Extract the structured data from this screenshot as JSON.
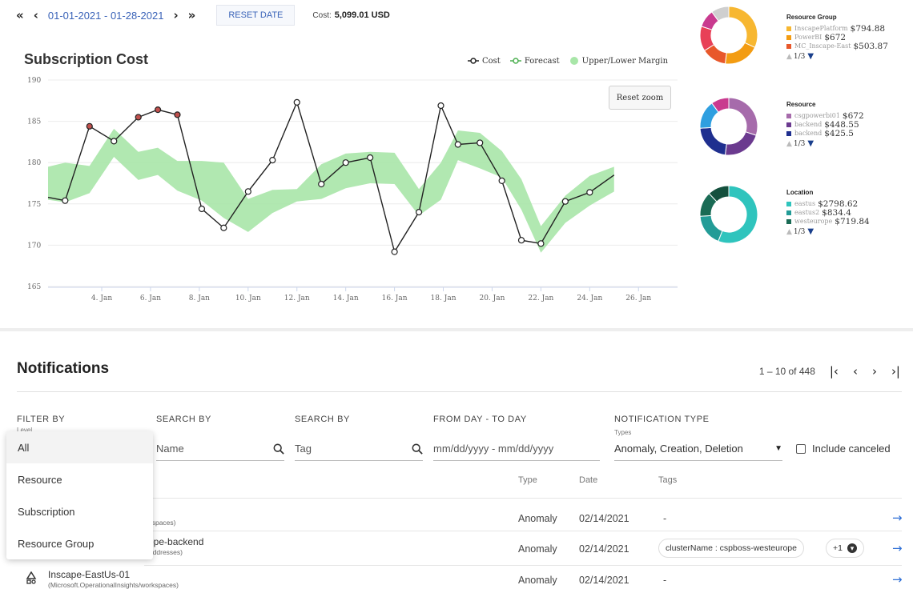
{
  "datebar": {
    "first_btn": "«",
    "prev_btn": "‹",
    "range": "01-01-2021 - 01-28-2021",
    "next_btn": "›",
    "last_btn": "»",
    "reset_label": "RESET DATE",
    "cost_label": "Cost:",
    "cost_value": "5,099.01 USD"
  },
  "chart_data": {
    "type": "line",
    "title": "Subscription Cost",
    "reset_zoom_label": "Reset zoom",
    "legend": [
      "Cost",
      "Forecast",
      "Upper/Lower Margin"
    ],
    "ylim": [
      165,
      190
    ],
    "y_ticks": [
      190,
      185,
      180,
      175,
      170,
      165
    ],
    "x_tick_labels": [
      "4. Jan",
      "6. Jan",
      "8. Jan",
      "10. Jan",
      "12. Jan",
      "14. Jan",
      "16. Jan",
      "18. Jan",
      "20. Jan",
      "22. Jan",
      "24. Jan",
      "26. Jan"
    ],
    "x_tick_days": [
      4,
      6,
      8,
      10,
      12,
      14,
      16,
      18,
      20,
      22,
      24,
      26
    ],
    "xlim": [
      1.8,
      27.6
    ],
    "cost": {
      "x": [
        1.8,
        2.5,
        3.5,
        4.5,
        5.5,
        6.3,
        7.1,
        8.1,
        9.0,
        10.0,
        11.0,
        12.0,
        13.0,
        14.0,
        15.0,
        16.0,
        17.0,
        17.9,
        18.6,
        19.5,
        20.4,
        21.2,
        22.0,
        23.0,
        24.0,
        25.0,
        26.0,
        27.0,
        27.6
      ],
      "y": [
        175.8,
        175.4,
        184.4,
        182.6,
        185.5,
        186.4,
        185.8,
        174.4,
        172.1,
        176.5,
        180.3,
        187.3,
        177.4,
        180.0,
        180.6,
        169.2,
        174.0,
        186.9,
        182.2,
        182.4,
        177.8,
        170.6,
        170.2,
        175.3,
        176.4,
        178.5,
        null,
        null,
        null
      ],
      "highlighted_points": [
        3.5,
        5.5,
        6.3,
        7.1
      ]
    },
    "margin_upper": {
      "x": [
        1.8,
        2.5,
        3.5,
        4.5,
        5.5,
        6.3,
        7.1,
        8.1,
        9.0,
        10.0,
        11.0,
        12.0,
        13.0,
        14.0,
        15.0,
        16.0,
        17.0,
        17.9,
        18.6,
        19.5,
        20.4,
        21.2,
        22.0,
        23.0,
        24.0,
        25.0,
        26.0,
        27.0,
        27.6
      ],
      "y": [
        179.5,
        180.0,
        179.6,
        184.1,
        181.3,
        181.8,
        180.2,
        180.2,
        180.0,
        175.6,
        176.7,
        176.8,
        179.8,
        181.1,
        181.3,
        181.2,
        176.8,
        180.0,
        183.9,
        183.6,
        181.4,
        178.0,
        172.3,
        176.0,
        178.4,
        179.5,
        null,
        null,
        null
      ]
    },
    "margin_lower": {
      "x": [
        1.8,
        2.5,
        3.5,
        4.5,
        5.5,
        6.3,
        7.1,
        8.1,
        9.0,
        10.0,
        11.0,
        12.0,
        13.0,
        14.0,
        15.0,
        16.0,
        17.0,
        17.9,
        18.6,
        19.5,
        20.4,
        21.2,
        22.0,
        23.0,
        24.0,
        25.0,
        26.0,
        27.0,
        27.6
      ],
      "y": [
        175.5,
        175.2,
        176.3,
        180.7,
        177.9,
        178.5,
        176.6,
        175.4,
        173.3,
        171.6,
        173.9,
        175.3,
        175.6,
        176.9,
        177.5,
        177.4,
        173.6,
        175.5,
        180.3,
        179.3,
        178.2,
        174.3,
        169.1,
        172.7,
        174.8,
        176.5,
        null,
        null,
        null
      ]
    },
    "colors": {
      "cost": "#222222",
      "forecast": "#4caf50",
      "margin": "#a8e6a8",
      "highlight": "#c0504d"
    }
  },
  "donuts": [
    {
      "title": "Resource Group",
      "segments": [
        {
          "value": 32,
          "color": "#f7b731"
        },
        {
          "value": 20,
          "color": "#f39c12"
        },
        {
          "value": 14,
          "color": "#e8582b"
        },
        {
          "value": 14,
          "color": "#e84057"
        },
        {
          "value": 10,
          "color": "#c93a8f"
        },
        {
          "value": 10,
          "color": "#cfcfcf"
        }
      ],
      "items": [
        {
          "name": "InscapePlatform",
          "value": "$794.88",
          "color": "#f7b731"
        },
        {
          "name": "PowerBI",
          "value": "$672",
          "color": "#f39c12"
        },
        {
          "name": "MC_Inscape-East",
          "value": "$503.87",
          "color": "#e8582b"
        }
      ],
      "pager": "1/3"
    },
    {
      "title": "Resource",
      "segments": [
        {
          "value": 30,
          "color": "#a66bab"
        },
        {
          "value": 22,
          "color": "#6b3a8f"
        },
        {
          "value": 22,
          "color": "#1f2f8f"
        },
        {
          "value": 16,
          "color": "#2f9fe0"
        },
        {
          "value": 10,
          "color": "#c93a8f"
        }
      ],
      "items": [
        {
          "name": "csgpowerbi01",
          "value": "$672",
          "color": "#a66bab"
        },
        {
          "name": "backend",
          "value": "$448.55",
          "color": "#6b3a8f"
        },
        {
          "name": "backend",
          "value": "$425.5",
          "color": "#1f2f8f"
        }
      ],
      "pager": "1/3"
    },
    {
      "title": "Location",
      "segments": [
        {
          "value": 56,
          "color": "#2fc4bd"
        },
        {
          "value": 18,
          "color": "#239c97"
        },
        {
          "value": 14,
          "color": "#1a6b55"
        },
        {
          "value": 12,
          "color": "#14503d"
        }
      ],
      "items": [
        {
          "name": "eastus",
          "value": "$2798.62",
          "color": "#2fc4bd"
        },
        {
          "name": "eastus2",
          "value": "$834.4",
          "color": "#239c97"
        },
        {
          "name": "westeurope",
          "value": "$719.84",
          "color": "#1a6b55"
        }
      ],
      "pager": "1/3"
    }
  ],
  "notifications": {
    "title": "Notifications",
    "pager_text": "1 – 10 of 448",
    "pager_first": "|‹",
    "pager_prev": "‹",
    "pager_next": "›",
    "pager_last": "›|",
    "filters": {
      "filter_by": "FILTER BY",
      "filter_sub": "Level",
      "search_by_1": "SEARCH BY",
      "search_ph_1": "Name",
      "search_by_2": "SEARCH BY",
      "search_ph_2": "Tag",
      "date_label": "FROM DAY - TO DAY",
      "date_ph": "mm/dd/yyyy - mm/dd/yyyy",
      "type_label": "NOTIFICATION TYPE",
      "type_sub": "Types",
      "type_value": "Anomaly, Creation, Deletion",
      "include_canceled": "Include canceled"
    },
    "columns": {
      "type": "Type",
      "date": "Date",
      "tags": "Tags"
    },
    "rows": [
      {
        "name": "",
        "resource_type": "espaces)",
        "type": "Anomaly",
        "date": "02/14/2021",
        "tags": "-"
      },
      {
        "name": "ope-backend",
        "resource_type": "Addresses)",
        "type": "Anomaly",
        "date": "02/14/2021",
        "tag_chip": "clusterName : cspboss-westeurope",
        "tag_more": "+1"
      },
      {
        "name": "Inscape-EastUs-01",
        "resource_type": "(Microsoft.OperationalInsights/workspaces)",
        "type": "Anomaly",
        "date": "02/14/2021",
        "tags": "-"
      }
    ],
    "row_arrow": "→",
    "dropdown": [
      "All",
      "Resource",
      "Subscription",
      "Resource Group"
    ]
  }
}
